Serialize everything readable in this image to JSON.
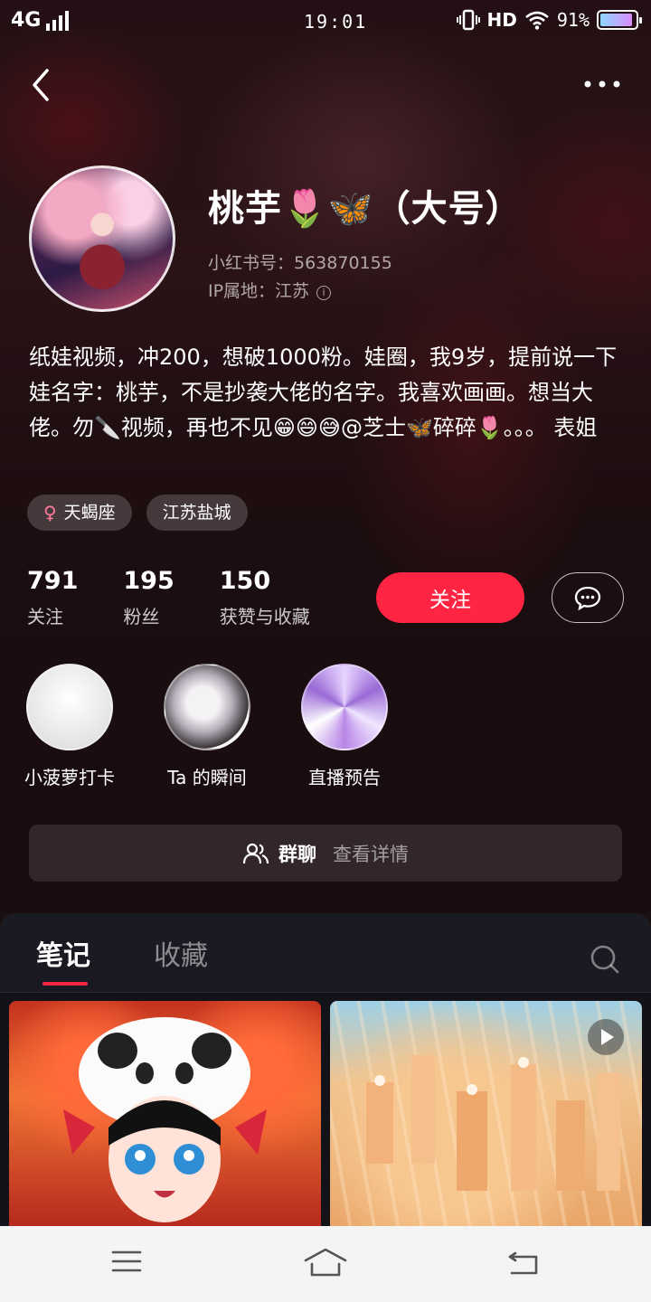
{
  "status_bar": {
    "network": "4G",
    "time": "19:01",
    "hd": "HD",
    "battery_percent_text": "91%",
    "battery_level": 0.91
  },
  "profile": {
    "nickname": "桃芋🌷🦋（大号）",
    "id_text": "小红书号：563870155",
    "ip_text": "IP属地：江苏",
    "bio": "纸娃视频，冲200，想破1000粉。娃圈，我9岁，提前说一下娃名字：桃芋，不是抄袭大佬的名字。我喜欢画画。想当大佬。勿🔪视频，再也不见😁😄😅@芝士🦋碎碎🌷。。。 表姐",
    "tags": [
      {
        "icon": "female-icon",
        "symbol": "♀",
        "label": "天蝎座"
      },
      {
        "label": "江苏盐城"
      }
    ]
  },
  "stats": [
    {
      "value": "791",
      "label": "关注"
    },
    {
      "value": "195",
      "label": "粉丝"
    },
    {
      "value": "150",
      "label": "获赞与收藏"
    }
  ],
  "actions": {
    "follow_label": "关注",
    "message_icon": "chat-bubble-icon"
  },
  "highlights": [
    {
      "label": "小菠萝打卡"
    },
    {
      "label": "Ta 的瞬间"
    },
    {
      "label": "直播预告"
    }
  ],
  "group_chat": {
    "title": "群聊",
    "subtitle": "查看详情",
    "icon": "group-icon"
  },
  "tabs": {
    "notes": "笔记",
    "collections": "收藏",
    "active": "notes"
  },
  "colors": {
    "accent": "#ff2442",
    "background_dark": "#1a1a22"
  },
  "navbar": {
    "menu_icon": "menu-icon",
    "home_icon": "home-icon",
    "back_icon": "back-return-icon"
  }
}
